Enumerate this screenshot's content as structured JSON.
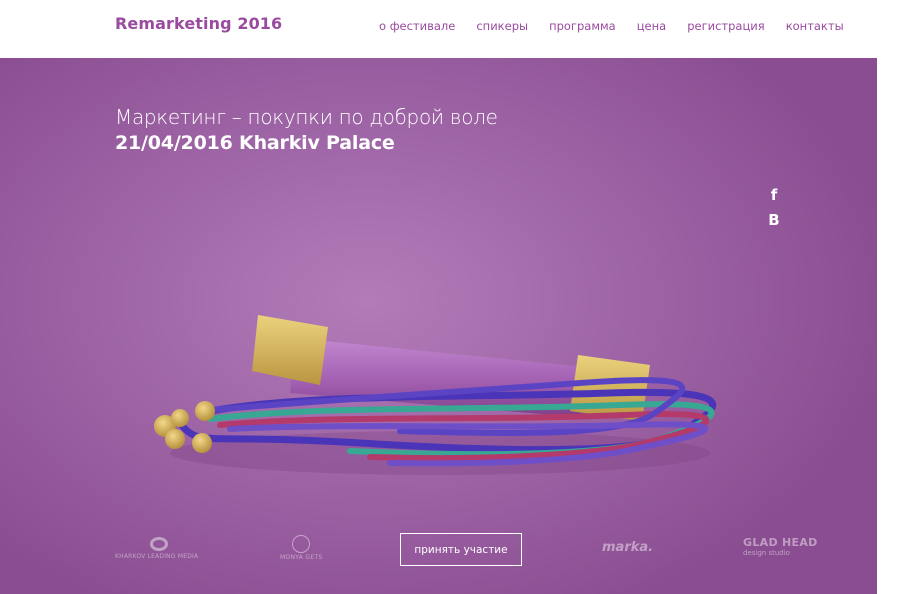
{
  "header": {
    "brand": "Remarketing 2016",
    "nav": [
      "о фестивале",
      "спикеры",
      "программа",
      "цена",
      "регистрация",
      "контакты"
    ]
  },
  "hero": {
    "headline": "Маркетинг – покупки по доброй воле",
    "date_place": "21/04/2016 Kharkiv Palace",
    "cta_label": "принять участие"
  },
  "social": [
    {
      "icon": "facebook-icon",
      "glyph": "f"
    },
    {
      "icon": "vk-icon",
      "glyph": "В"
    }
  ],
  "partners": {
    "kharkov": "KHARKOV LEADING MEDIA",
    "monya": "MONYA GETS",
    "marka": "marka.",
    "glad": "GLAD HEAD",
    "glad_sub": "design studio"
  },
  "colors": {
    "brand": "#9a4a9f",
    "hero_bg": "#a067a8",
    "text_on_hero": "#ffffff"
  }
}
